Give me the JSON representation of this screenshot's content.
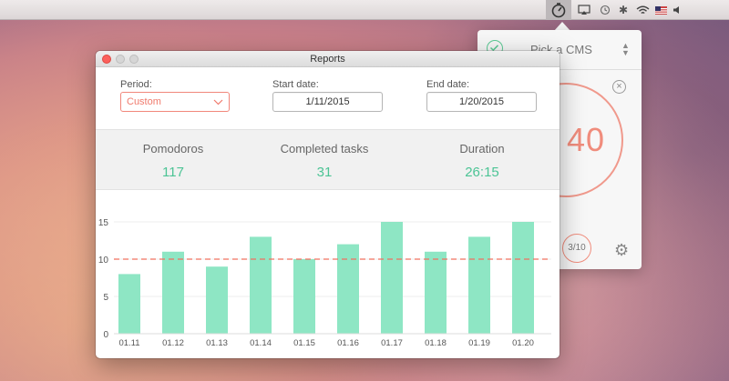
{
  "menubar": {
    "icons": [
      "pomodoro-timer-icon",
      "airplay-icon",
      "time-machine-icon",
      "bluetooth-icon",
      "wifi-icon",
      "us-flag-icon",
      "volume-icon"
    ]
  },
  "popover": {
    "task": "Pick a CMS",
    "timer": "40",
    "tomato_count": "3/10",
    "close": "×"
  },
  "window": {
    "title": "Reports",
    "period_label": "Period:",
    "period_value": "Custom",
    "start_label": "Start date:",
    "start_value": "1/11/2015",
    "end_label": "End date:",
    "end_value": "1/20/2015"
  },
  "stats": {
    "pomodoros_label": "Pomodoros",
    "pomodoros_value": "117",
    "tasks_label": "Completed tasks",
    "tasks_value": "31",
    "duration_label": "Duration",
    "duration_value": "26:15"
  },
  "colors": {
    "accent": "#4cc495",
    "bar": "#8ee6c4",
    "average": "#f0705f",
    "select_border": "#f1877b"
  },
  "chart_data": {
    "type": "bar",
    "categories": [
      "01.11",
      "01.12",
      "01.13",
      "01.14",
      "01.15",
      "01.16",
      "01.17",
      "01.18",
      "01.19",
      "01.20"
    ],
    "values": [
      8,
      11,
      9,
      13,
      10,
      12,
      15,
      11,
      13,
      15
    ],
    "yticks": [
      "0",
      "5",
      "10",
      "15"
    ],
    "ylim": [
      0,
      15
    ],
    "average": 10,
    "grid": true
  }
}
